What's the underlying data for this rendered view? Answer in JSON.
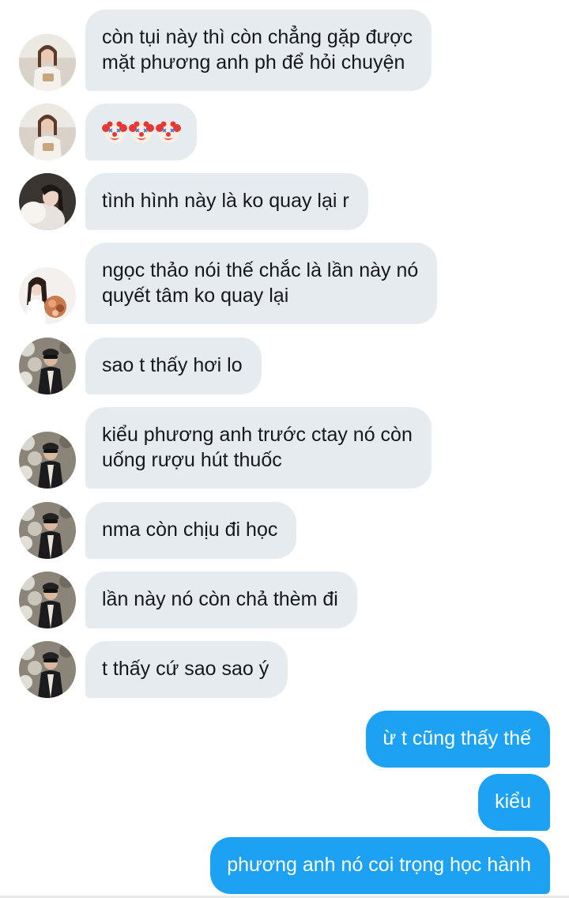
{
  "messages": [
    {
      "sender": "friend-a",
      "lines": [
        "còn tụi này thì còn chẳng gặp được",
        "mặt phương anh ph để hỏi chuyện"
      ]
    },
    {
      "sender": "friend-a",
      "emoji": [
        "clown-icon",
        "clown-icon",
        "clown-icon"
      ]
    },
    {
      "sender": "friend-b",
      "lines": [
        "tình hình này là ko quay lại r"
      ]
    },
    {
      "sender": "friend-c",
      "lines": [
        "ngọc thảo nói thế chắc là lần này nó",
        "quyết tâm ko quay lại"
      ]
    },
    {
      "sender": "friend-d",
      "lines": [
        "sao t thấy hơi lo"
      ]
    },
    {
      "sender": "friend-d",
      "lines": [
        "kiểu phương anh trước ctay nó còn",
        "uống rượu hút thuốc"
      ]
    },
    {
      "sender": "friend-d",
      "lines": [
        "nma còn chịu đi học"
      ]
    },
    {
      "sender": "friend-d",
      "lines": [
        "lần này nó còn chả thèm đi"
      ]
    },
    {
      "sender": "friend-d",
      "lines": [
        "t thấy cứ sao sao ý"
      ]
    },
    {
      "sender": "me",
      "lines": [
        "ừ t cũng thấy thế"
      ]
    },
    {
      "sender": "me",
      "lines": [
        "kiểu"
      ]
    },
    {
      "sender": "me",
      "lines": [
        "phương anh nó coi trọng học hành"
      ]
    }
  ],
  "colors": {
    "incoming_bubble": "#e6ebef",
    "outgoing_bubble": "#1da1f2",
    "text": "#16181b"
  }
}
